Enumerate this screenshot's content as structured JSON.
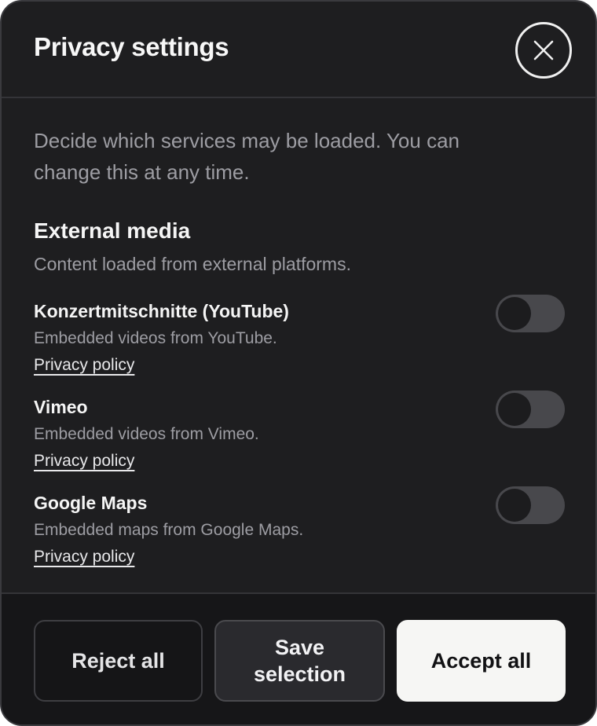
{
  "dialog": {
    "title": "Privacy settings",
    "close_icon": "close-icon",
    "intro": "Decide which services may be loaded. You can change this at any time."
  },
  "section": {
    "title": "External media",
    "description": "Content loaded from external platforms."
  },
  "services": [
    {
      "name": "Konzertmitschnitte (YouTube)",
      "description": "Embedded videos from YouTube.",
      "link": "Privacy policy",
      "enabled": false
    },
    {
      "name": "Vimeo",
      "description": "Embedded videos from Vimeo.",
      "link": "Privacy policy",
      "enabled": false
    },
    {
      "name": "Google Maps",
      "description": "Embedded maps from Google Maps.",
      "link": "Privacy policy",
      "enabled": false
    }
  ],
  "footer": {
    "reject_label": "Reject all",
    "save_label": "Save selection",
    "accept_label": "Accept all"
  },
  "colors": {
    "background": "#1e1e20",
    "footer_background": "#161618",
    "toggle_off": "#48484c",
    "accept_button": "#f6f6f4"
  }
}
